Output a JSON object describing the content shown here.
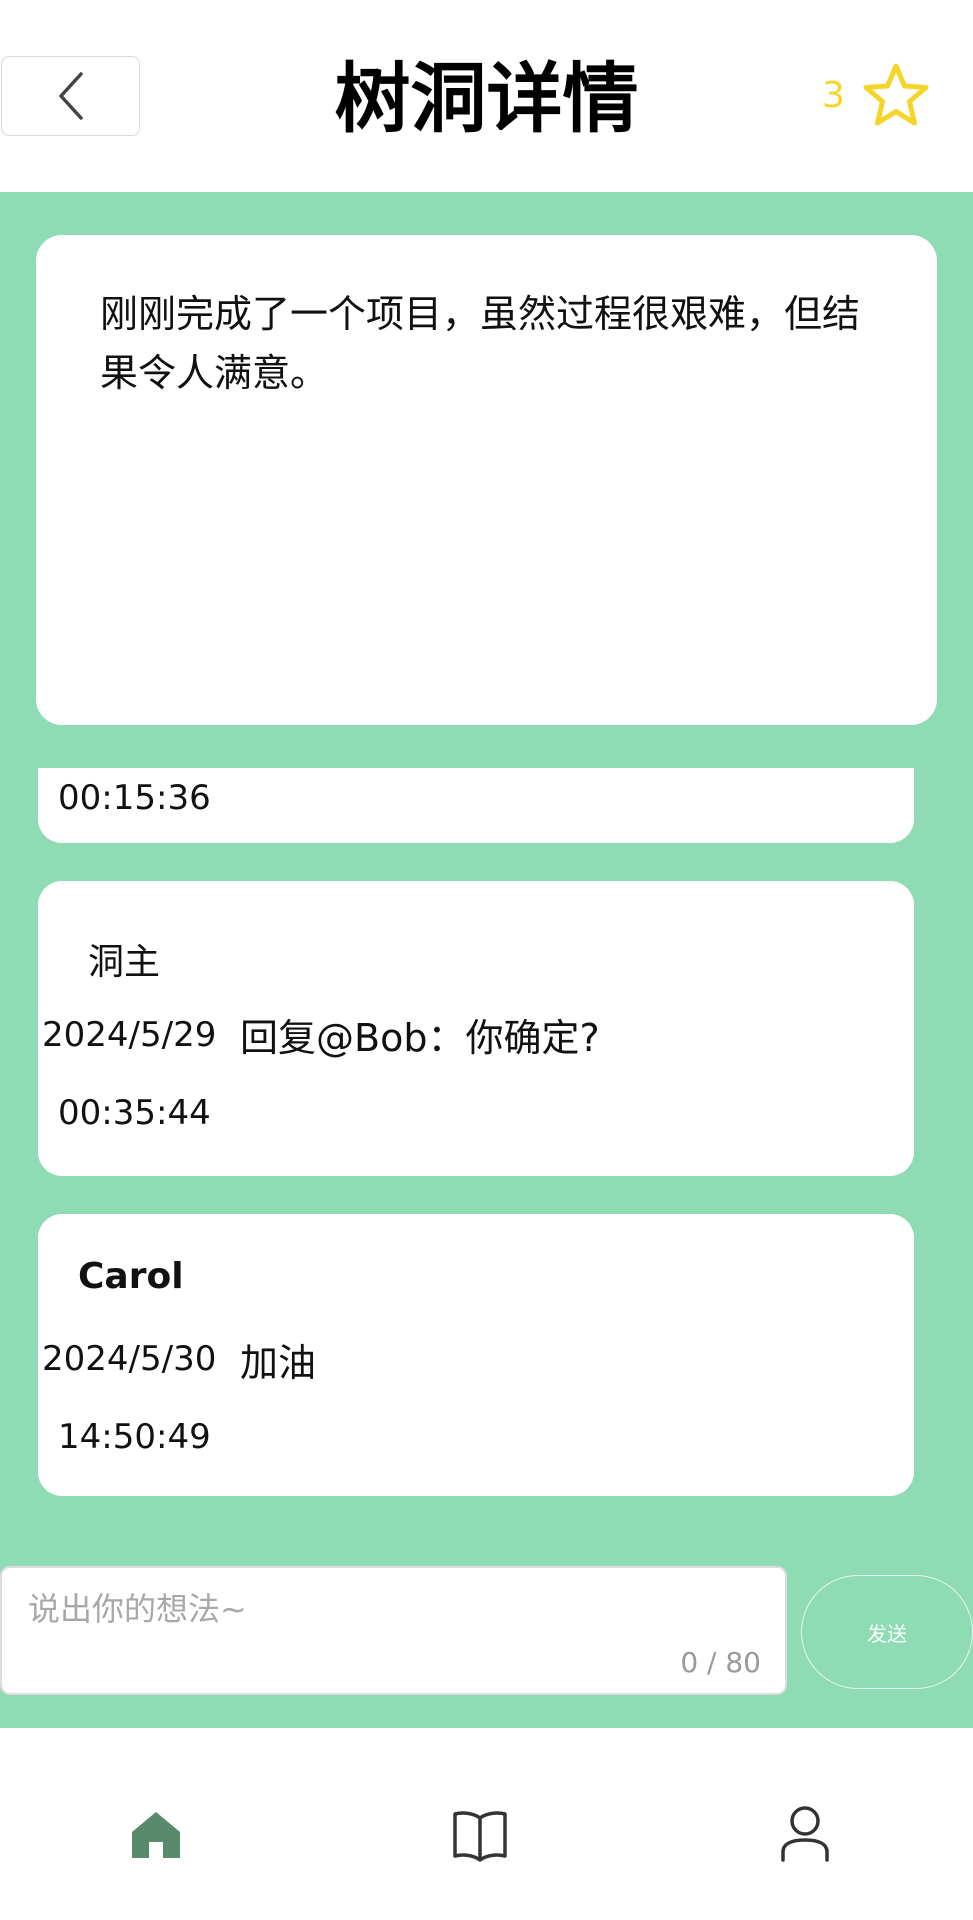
{
  "header": {
    "title": "树洞详情",
    "back_icon": "chevron-left-icon",
    "star_count": "3",
    "star_icon": "star-outline-icon",
    "star_color": "#f5d52a"
  },
  "post": {
    "text": "刚刚完成了一个项目，虽然过程很艰难，但结果令人满意。"
  },
  "comments": [
    {
      "time": "00:15:36"
    },
    {
      "author": "洞主",
      "date": "2024/5/29",
      "time": "00:35:44",
      "text": "回复@Bob：你确定?"
    },
    {
      "author": "Carol",
      "date": "2024/5/30",
      "time": "14:50:49",
      "text": "加油"
    }
  ],
  "input": {
    "placeholder": "说出你的想法~",
    "counter": "0 / 80",
    "send_label": "发送"
  },
  "bottom_nav": {
    "items": [
      {
        "icon": "home-icon",
        "active": true
      },
      {
        "icon": "book-icon",
        "active": false
      },
      {
        "icon": "user-icon",
        "active": false
      }
    ]
  },
  "colors": {
    "background_green": "#8fdbb4",
    "active_nav": "#5a8a6c",
    "inactive_nav": "#333333"
  }
}
